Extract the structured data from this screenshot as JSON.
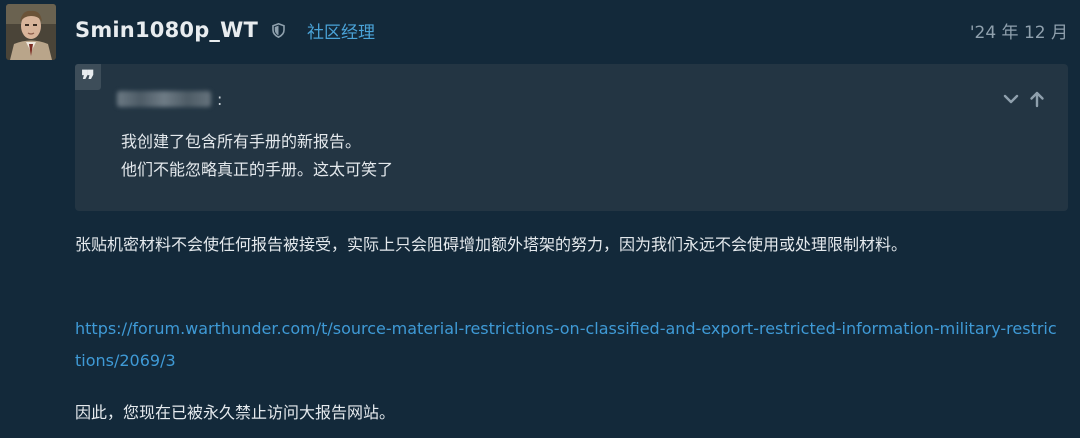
{
  "post": {
    "username": "Smin1080p_WT",
    "role": "社区经理",
    "date": "'24 年 12 月",
    "quote": {
      "author_suffix": ":",
      "lines": [
        "我创建了包含所有手册的新报告。",
        "他们不能忽略真正的手册。这太可笑了"
      ]
    },
    "body": [
      "张贴机密材料不会使任何报告被接受，实际上只会阻碍增加额外塔架的努力，因为我们永远不会使用或处理限制材料。",
      "https://forum.warthunder.com/t/source-material-restrictions-on-classified-and-export-restricted-information-military-restrictions/2069/3",
      "因此，您现在已被永久禁止访问大报告网站。"
    ]
  },
  "icons": {
    "shield": "shield-icon",
    "quote": "quote-icon",
    "expand": "chevron-down-icon",
    "jump": "arrow-up-icon"
  },
  "colors": {
    "background": "#13293a",
    "quote_bg": "#233543",
    "link": "#3f9ad6",
    "role": "#4aa3d8"
  }
}
